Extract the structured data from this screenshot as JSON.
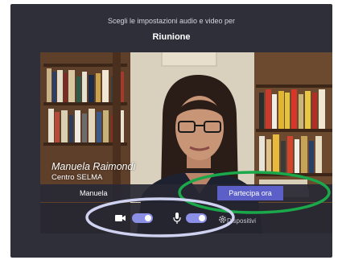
{
  "dialog": {
    "subtitle": "Scegli le impostazioni audio e video per",
    "title": "Riunione"
  },
  "preview": {
    "overlay_name": "Manuela Raimondi",
    "overlay_org": "Centro SELMA"
  },
  "name_bar": {
    "name": "Manuela",
    "join_label": "Partecipa ora"
  },
  "controls": {
    "camera_icon": "video-camera-icon",
    "camera_on": true,
    "mic_icon": "microphone-icon",
    "mic_on": true,
    "devices_icon": "gear-icon",
    "devices_label": "Dispositivi"
  },
  "colors": {
    "background": "#2f2f3a",
    "accent": "#5b5fc7",
    "toggle": "#8b8fe6",
    "annotation_green": "#1aa84a",
    "annotation_lavender": "#cfd2f0"
  }
}
